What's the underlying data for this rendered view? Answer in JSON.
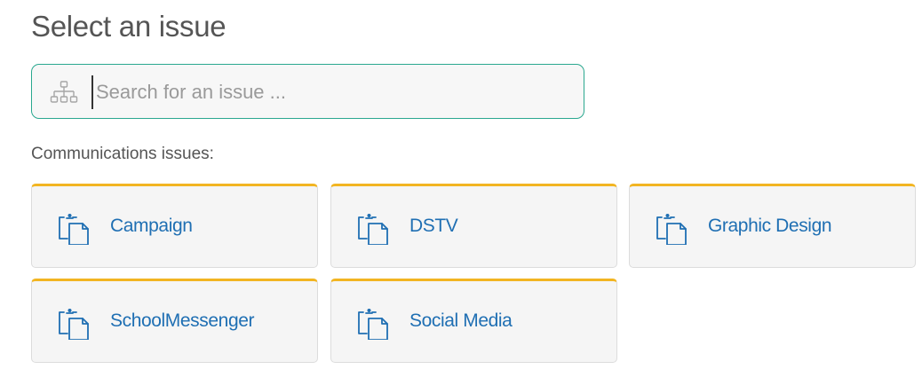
{
  "header": {
    "title": "Select an issue"
  },
  "search": {
    "placeholder": "Search for an issue ...",
    "value": "",
    "icon": "sitemap-icon"
  },
  "section": {
    "label": "Communications issues:"
  },
  "issues": [
    {
      "label": "Campaign",
      "icon": "clipboard-icon"
    },
    {
      "label": "DSTV",
      "icon": "clipboard-icon"
    },
    {
      "label": "Graphic Design",
      "icon": "clipboard-icon"
    },
    {
      "label": "SchoolMessenger",
      "icon": "clipboard-icon"
    },
    {
      "label": "Social Media",
      "icon": "clipboard-icon"
    }
  ],
  "colors": {
    "accent_border": "#f2b522",
    "search_border": "#2aa88f",
    "link": "#1f6fb3",
    "card_background": "#f5f5f5"
  }
}
